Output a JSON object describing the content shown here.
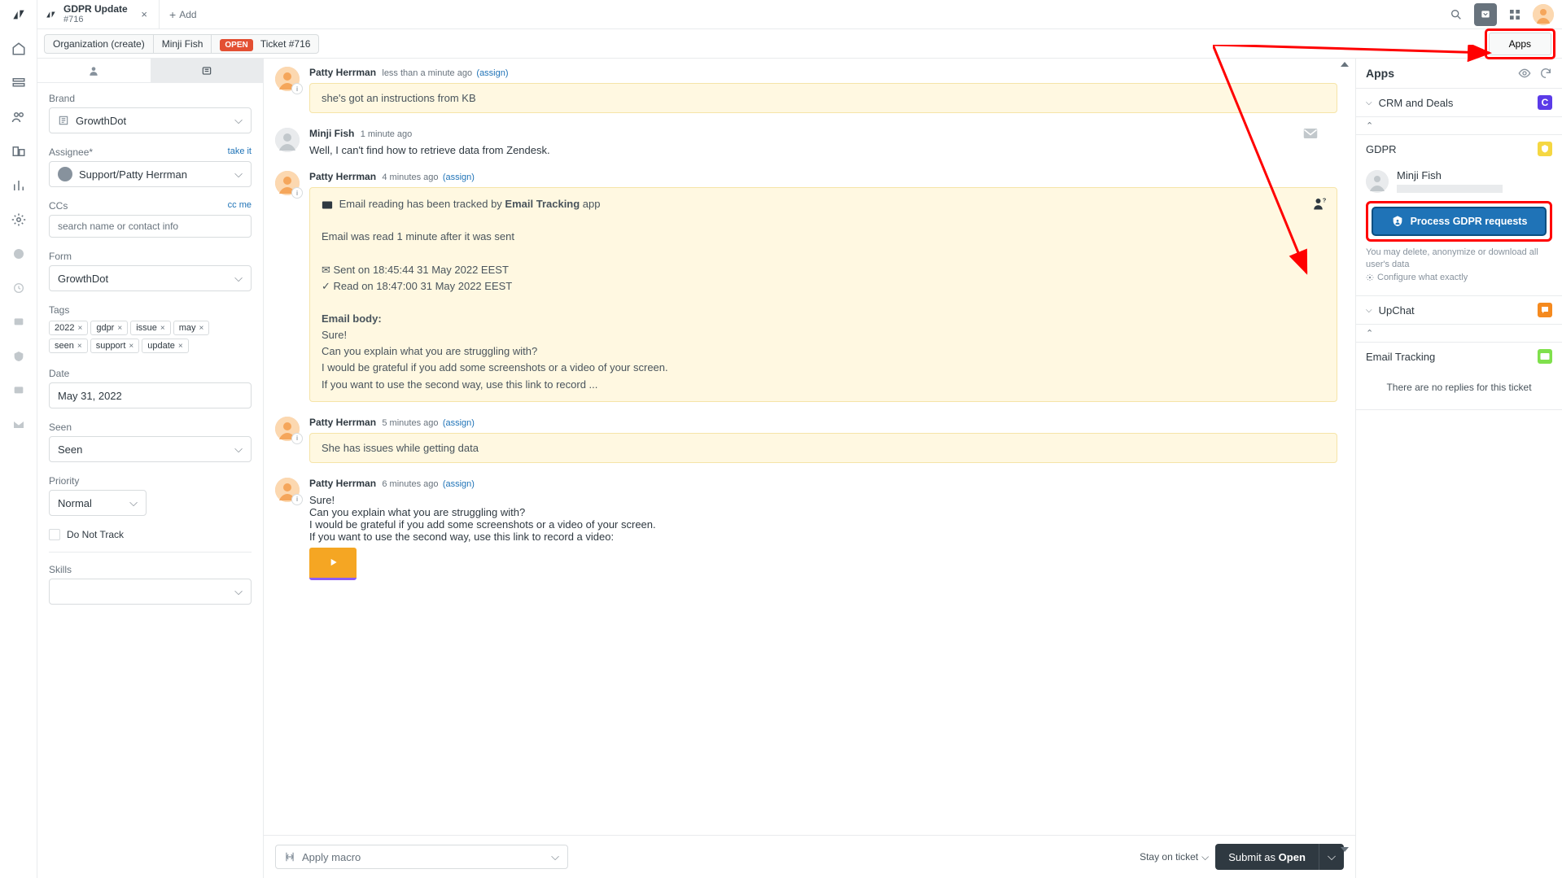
{
  "tab": {
    "title": "GDPR Update",
    "sub": "#716",
    "add_label": "Add"
  },
  "breadcrumb": {
    "org": "Organization (create)",
    "user": "Minji Fish",
    "status": "OPEN",
    "ticket": "Ticket #716",
    "apps_btn": "Apps"
  },
  "sidebar": {
    "brand_label": "Brand",
    "brand_value": "GrowthDot",
    "assignee_label": "Assignee*",
    "take_it": "take it",
    "assignee_value": "Support/Patty Herrman",
    "ccs_label": "CCs",
    "cc_me": "cc me",
    "ccs_placeholder": "search name or contact info",
    "form_label": "Form",
    "form_value": "GrowthDot",
    "tags_label": "Tags",
    "tags": [
      "2022",
      "gdpr",
      "issue",
      "may",
      "seen",
      "support",
      "update"
    ],
    "date_label": "Date",
    "date_value": "May 31, 2022",
    "seen_label": "Seen",
    "seen_value": "Seen",
    "priority_label": "Priority",
    "priority_value": "Normal",
    "dnt_label": "Do Not Track",
    "skills_label": "Skills"
  },
  "msgs": {
    "m0": {
      "author": "Patty Herrman",
      "time": "less than a minute ago",
      "assign": "(assign)",
      "body": "she's got an instructions from KB"
    },
    "m1": {
      "author": "Minji Fish",
      "time": "1 minute ago",
      "body": "Well, I can't find how to retrieve data from Zendesk."
    },
    "m2": {
      "author": "Patty Herrman",
      "time": "4 minutes ago",
      "assign": "(assign)",
      "tracked_pre": "Email reading has been tracked by ",
      "tracked_strong": "Email Tracking",
      "tracked_suf": " app",
      "read_line": "Email was read 1 minute after it was sent",
      "sent_line": "Sent on 18:45:44 31 May 2022 EEST",
      "read_on": "Read on 18:47:00 31 May 2022 EEST",
      "body_label": "Email body:",
      "b1": "Sure!",
      "b2": "Can you explain what you are struggling with?",
      "b3": "I would be grateful if you add some screenshots or a video of your screen.",
      "b4": "If you want to use the second way, use this link to record ..."
    },
    "m3": {
      "author": "Patty Herrman",
      "time": "5 minutes ago",
      "assign": "(assign)",
      "body": "She has issues while getting data"
    },
    "m4": {
      "author": "Patty Herrman",
      "time": "6 minutes ago",
      "assign": "(assign)",
      "b1": "Sure!",
      "b2": "Can you explain what you are struggling with?",
      "b3": "I would be grateful if you add some screenshots or a video of your screen.",
      "b4": "If you want to use the second way, use this link to record a video:"
    }
  },
  "macro": {
    "placeholder": "Apply macro",
    "stay": "Stay on ticket",
    "submit_pre": "Submit as ",
    "submit_status": "Open"
  },
  "apps": {
    "title": "Apps",
    "crm": {
      "label": "CRM and Deals"
    },
    "gdpr": {
      "label": "GDPR",
      "user": "Minji Fish",
      "process": "Process GDPR requests",
      "note": "You may delete, anonymize or download all user's data",
      "configure": "Configure what exactly"
    },
    "upchat": {
      "label": "UpChat"
    },
    "et": {
      "label": "Email Tracking",
      "body": "There are no replies for this ticket"
    }
  },
  "colors": {
    "crm": "#5b3be8",
    "gdpr_bg": "#f5d742",
    "upchat": "#f58a1f",
    "et": "#7fe04c"
  }
}
